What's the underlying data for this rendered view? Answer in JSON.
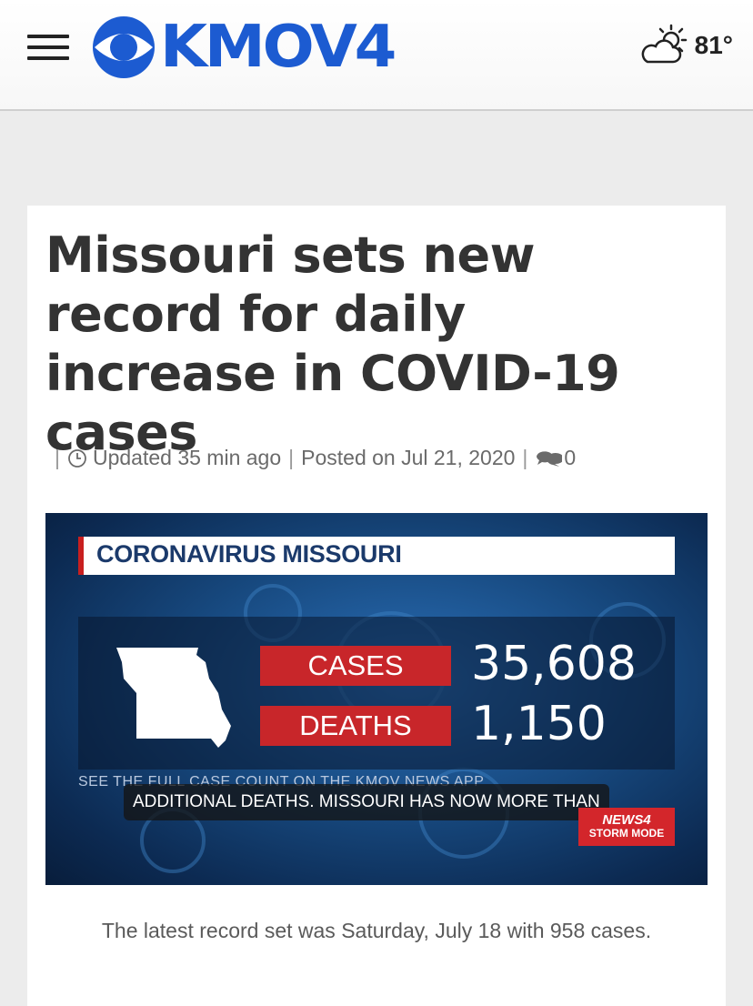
{
  "header": {
    "logo_text": "KMOV4",
    "weather": {
      "icon": "partly-sunny-icon",
      "temperature": "81°"
    },
    "brand_color": "#1c5bd1"
  },
  "article": {
    "headline": "Missouri sets new record for daily increase in COVID-19 cases",
    "meta": {
      "updated": "Updated 35 min ago",
      "posted": "Posted on Jul 21, 2020",
      "comment_count": "0"
    },
    "media": {
      "graphic_title": "CORONAVIRUS MISSOURI",
      "cases_label": "CASES",
      "cases_value": "35,608",
      "deaths_label": "DEATHS",
      "deaths_value": "1,150",
      "ticker": "SEE THE FULL CASE COUNT ON THE KMOV NEWS APP",
      "caption": "ADDITIONAL DEATHS. MISSOURI HAS NOW MORE THAN",
      "bug_line1": "NEWS4",
      "bug_line2": "STORM MODE",
      "accent_red": "#c8262a"
    },
    "summary": "The latest record set was Saturday, July 18 with 958 cases."
  }
}
